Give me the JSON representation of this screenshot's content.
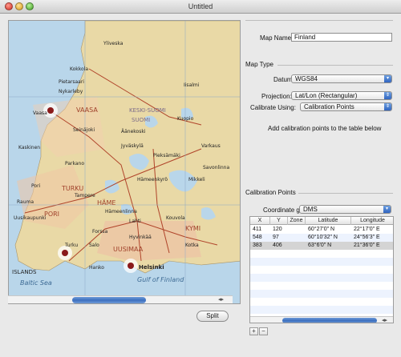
{
  "window": {
    "title": "Untitled"
  },
  "map": {
    "places": {
      "yliveska": "Yliveska",
      "kokkola": "Kokkola",
      "pietarsaari": "Pietarsaari",
      "nykarleby": "Nykarleby",
      "iisalmi": "Iisalmi",
      "vaasa_city": "Vaasa",
      "vaasa_region": "VAASA",
      "keski_suomi": "KESKI-SUOMI",
      "kuopio": "Kuopio",
      "seinajoki": "Seinäjoki",
      "aanekoski": "Äänekoski",
      "kaskinen": "Kaskinen",
      "jyvaskyla": "Jyväskylä",
      "varkaus": "Varkaus",
      "pieksamaki": "Pieksämäki",
      "parkano": "Parkano",
      "savonlinna": "Savonlinna",
      "mikkeli": "Mikkeli",
      "pori_city": "Pori",
      "turku_region": "TURKU",
      "tampere": "Tampere",
      "rauma": "Rauma",
      "hame": "HÄME",
      "lahti": "Lahti",
      "kouvola": "Kouvola",
      "kymi": "KYMI",
      "hameenlinna": "Hämeenlinna",
      "uusikaupunki": "Uusikaupunki",
      "turku_city": "Turku",
      "kotka": "Kotka",
      "salo": "Salo",
      "hyvinkaa": "Hyvinkää",
      "uusimaa": "UUSIMAA",
      "forssa": "Forssa",
      "helsinki": "Helsinki",
      "hanko": "Hanko",
      "islands": "ISLANDS",
      "baltic_sea": "Baltic Sea",
      "gulf_of_finland": "Gulf of Finland",
      "suomi": "SUOMI",
      "hame_small": "Hämeenkyrö",
      "pori_region": "PORI"
    }
  },
  "split_button": "Split",
  "form": {
    "map_name_label": "Map Name:",
    "map_name_value": "Finland",
    "map_type_header": "Map Type",
    "datum_label": "Datum:",
    "datum_value": "WGS84",
    "projection_label": "Projection:",
    "projection_value": "Lat/Lon (Rectangular)",
    "calibrate_label": "Calibrate Using:",
    "calibrate_value": "Calibration Points",
    "hint": "Add calibration points to the table below",
    "calibration_header": "Calibration Points",
    "coord_grid_label": "Coordinate grid:",
    "coord_grid_value": "DMS"
  },
  "table": {
    "columns": [
      "X",
      "Y",
      "Zone",
      "Latitude",
      "Longitude"
    ],
    "rows": [
      [
        "411",
        "120",
        "",
        "60°27'0\" N",
        "22°17'0\" E"
      ],
      [
        "548",
        "97",
        "",
        "60°10'32\" N",
        "24°56'3\" E"
      ],
      [
        "383",
        "406",
        "",
        "63°6'0\" N",
        "21°36'0\" E"
      ]
    ]
  },
  "buttons": {
    "add": "+",
    "remove": "−"
  },
  "colors": {
    "accent": "#3c6fbf",
    "sea": "#b9d6ea",
    "land": "#e9d9a6"
  }
}
